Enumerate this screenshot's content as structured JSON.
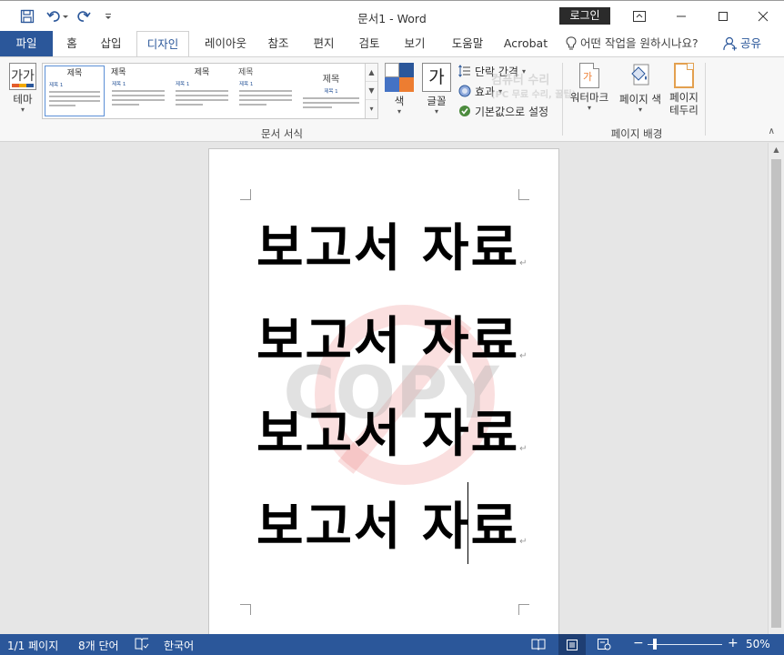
{
  "window": {
    "title": "문서1 - Word",
    "login_label": "로그인"
  },
  "tabs": [
    {
      "label": "파일"
    },
    {
      "label": "홈"
    },
    {
      "label": "삽입"
    },
    {
      "label": "디자인"
    },
    {
      "label": "레이아웃"
    },
    {
      "label": "참조"
    },
    {
      "label": "편지"
    },
    {
      "label": "검토"
    },
    {
      "label": "보기"
    },
    {
      "label": "도움말"
    },
    {
      "label": "Acrobat"
    }
  ],
  "tellme": {
    "label": "어떤 작업을 원하시나요?"
  },
  "share": {
    "label": "공유"
  },
  "ribbon": {
    "theme_icon_text": "가가",
    "theme_label": "테마",
    "styles": [
      {
        "title": "제목",
        "heading": "제목 1"
      },
      {
        "title": "제목",
        "heading": "제목 1"
      },
      {
        "title": "제목",
        "heading": "제목 1"
      },
      {
        "title": "제목",
        "heading": "제목 1"
      },
      {
        "title": "제목",
        "heading": "제목 1"
      }
    ],
    "color_label": "색",
    "font_icon_text": "가",
    "font_label": "글꼴",
    "paragraph_spacing_label": "단락 간격",
    "effects_label": "효과",
    "set_default_label": "기본값으로 설정",
    "watermark_label": "워터마크",
    "page_color_label": "페이지 색",
    "page_border_label_1": "페이지",
    "page_border_label_2": "테두리",
    "group_document_format": "문서 서식",
    "group_page_background": "페이지 배경",
    "overlay_line1": "컴퓨터 수리",
    "overlay_line2": "(PC 무료 수리, 꿀팁)",
    "colors": {
      "swatch1": "#ffffff",
      "swatch2": "#2b579a",
      "swatch3": "#4472c4",
      "swatch4": "#ed7d31"
    }
  },
  "document": {
    "lines": [
      "보고서 자료",
      "보고서 자료",
      "보고서 자료",
      "보고서 자료"
    ],
    "watermark_text": "COPY"
  },
  "status": {
    "page": "1/1 페이지",
    "words": "8개 단어",
    "language": "한국어",
    "zoom": "50%",
    "zoom_minus": "−",
    "zoom_plus": "+"
  }
}
